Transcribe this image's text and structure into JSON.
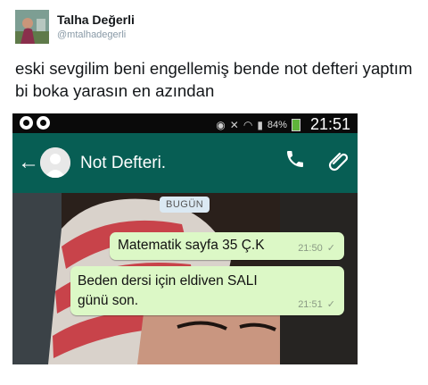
{
  "tweet": {
    "name": "Talha Değerli",
    "handle": "@mtalhadegerli",
    "text": "eski sevgilim beni engellemiş bende not defteri yaptım bi boka yarasın en azından"
  },
  "phone": {
    "status": {
      "battery": "84%",
      "time": "21:51"
    },
    "appbar": {
      "title": "Not Defteri."
    },
    "chat": {
      "date_chip": "BUGÜN",
      "messages": [
        {
          "text": "Matematik sayfa 35 Ç.K",
          "time": "21:50",
          "ticks": "✓"
        },
        {
          "text": "Beden dersi için eldiven SALI günü son.",
          "time": "21:51",
          "ticks": "✓"
        }
      ]
    }
  }
}
